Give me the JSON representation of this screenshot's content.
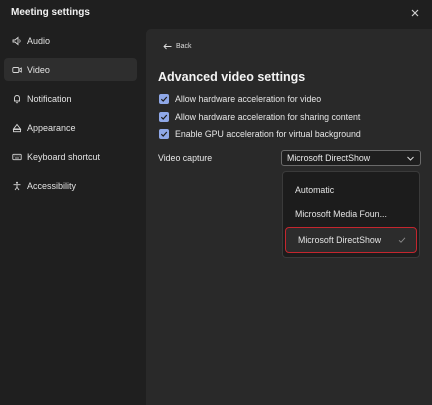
{
  "window": {
    "title": "Meeting settings",
    "close_icon": "close-icon"
  },
  "sidebar": {
    "items": [
      {
        "label": "Audio",
        "icon": "speaker-icon",
        "active": false
      },
      {
        "label": "Video",
        "icon": "video-camera-icon",
        "active": true
      },
      {
        "label": "Notification",
        "icon": "bell-icon",
        "active": false
      },
      {
        "label": "Appearance",
        "icon": "paint-icon",
        "active": false
      },
      {
        "label": "Keyboard shortcut",
        "icon": "keyboard-icon",
        "active": false
      },
      {
        "label": "Accessibility",
        "icon": "accessibility-icon",
        "active": false
      }
    ]
  },
  "panel": {
    "back_label": "Back",
    "title": "Advanced video settings",
    "options": [
      {
        "label": "Allow hardware acceleration for video",
        "checked": true
      },
      {
        "label": "Allow hardware acceleration for sharing content",
        "checked": true
      },
      {
        "label": "Enable GPU acceleration for virtual background",
        "checked": true
      }
    ],
    "video_capture": {
      "label": "Video capture",
      "selected": "Microsoft DirectShow",
      "menu": [
        "Automatic",
        "Microsoft Media Foun...",
        "Microsoft DirectShow"
      ]
    }
  },
  "colors": {
    "accent": "#8fa8e8",
    "highlight_border": "#c4262e",
    "background": "#1f1f1f"
  }
}
